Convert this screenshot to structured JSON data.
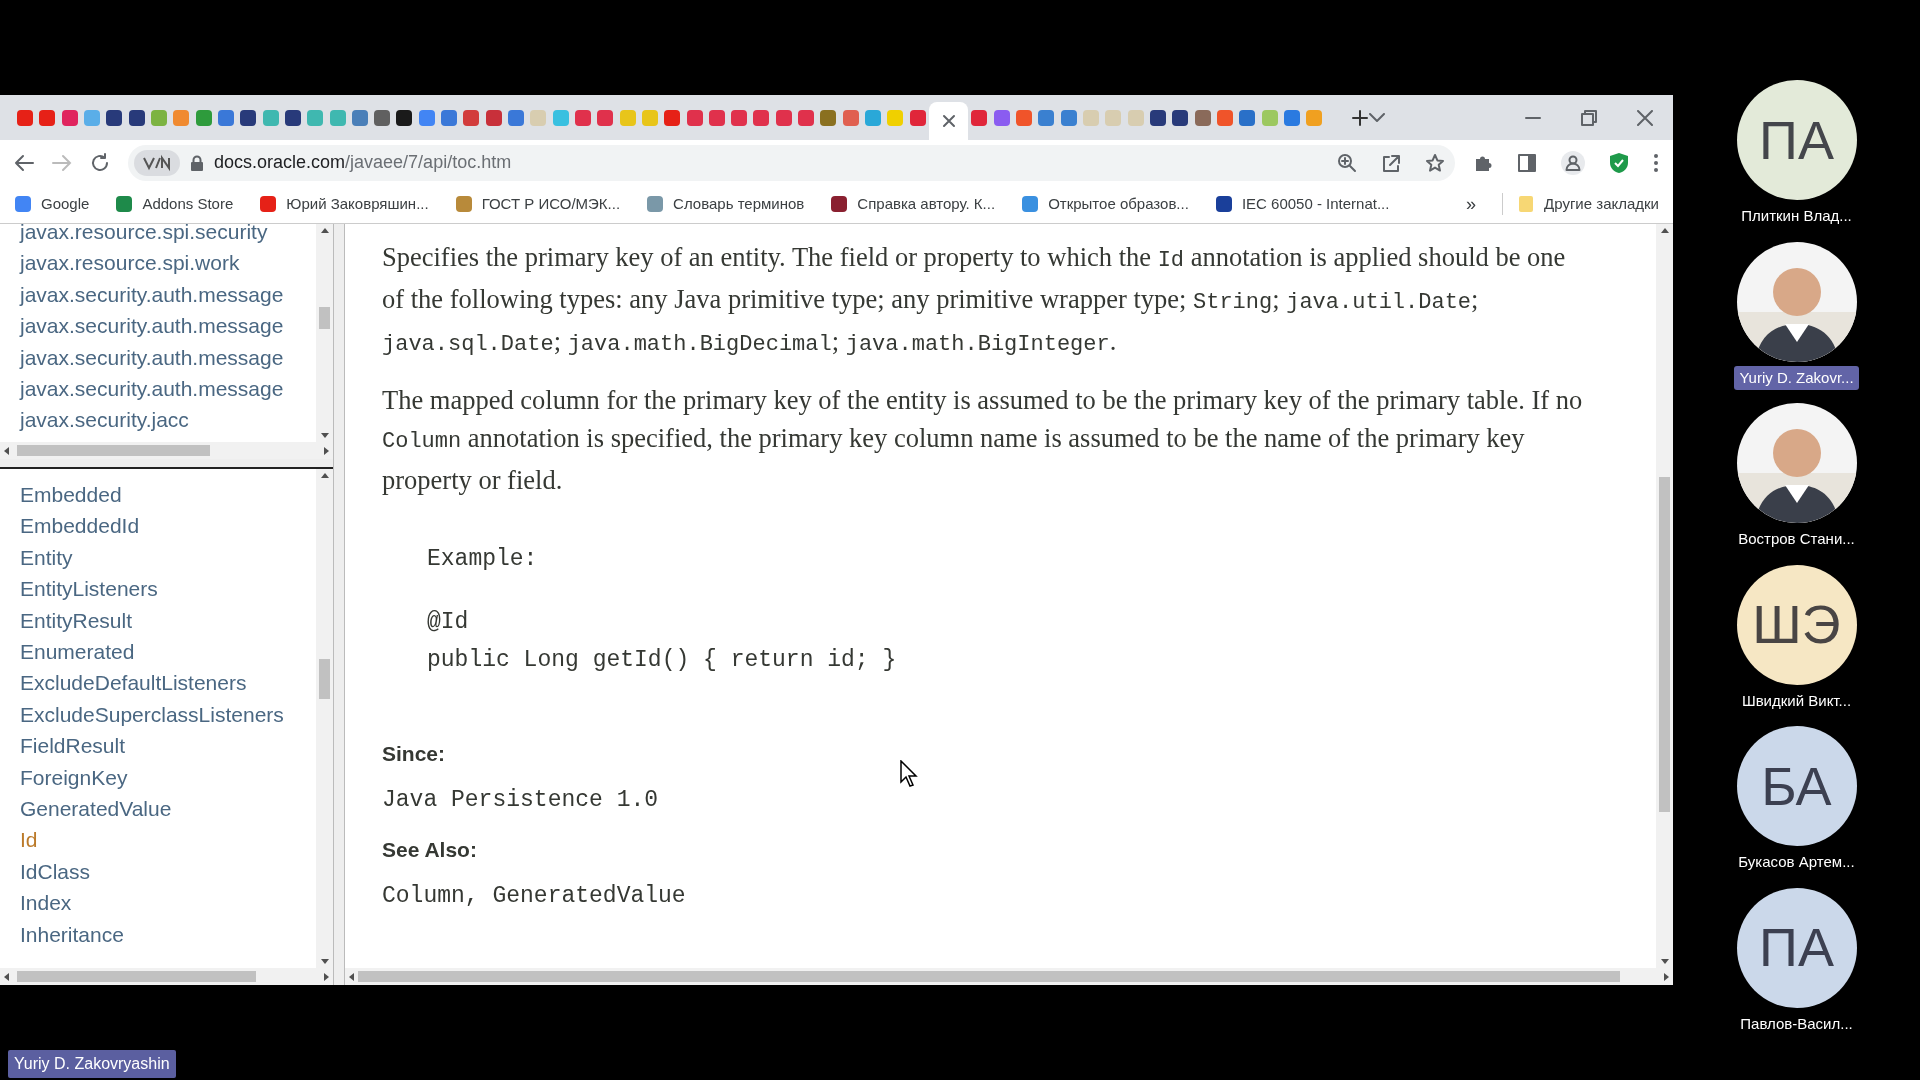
{
  "browser": {
    "tabs": [
      {
        "color": "#e62117",
        "selected": false
      },
      {
        "color": "#e62117",
        "selected": false
      },
      {
        "color": "#e0245e",
        "selected": false
      },
      {
        "color": "#5aaee8",
        "selected": false
      },
      {
        "color": "#283a7a",
        "selected": false
      },
      {
        "color": "#283a7a",
        "selected": false
      },
      {
        "color": "#7cb342",
        "selected": false
      },
      {
        "color": "#f08a30",
        "selected": false
      },
      {
        "color": "#2e9b3c",
        "selected": false
      },
      {
        "color": "#3a78d8",
        "selected": false
      },
      {
        "color": "#283a7a",
        "selected": false
      },
      {
        "color": "#3fb8b0",
        "selected": false
      },
      {
        "color": "#283a7a",
        "selected": false
      },
      {
        "color": "#3fb8b0",
        "selected": false
      },
      {
        "color": "#3fb8b0",
        "selected": false
      },
      {
        "color": "#4a7fb8",
        "selected": false
      },
      {
        "color": "#606060",
        "selected": false
      },
      {
        "color": "#1a1a1a",
        "selected": false
      },
      {
        "color": "#4285f4",
        "selected": false
      },
      {
        "color": "#3a78d8",
        "selected": false
      },
      {
        "color": "#d23c3c",
        "selected": false
      },
      {
        "color": "#c8303a",
        "selected": false
      },
      {
        "color": "#3a78d8",
        "selected": false
      },
      {
        "color": "#d8cdb0",
        "selected": false
      },
      {
        "color": "#39c0e0",
        "selected": false
      },
      {
        "color": "#e0314c",
        "selected": false
      },
      {
        "color": "#e0314c",
        "selected": false
      },
      {
        "color": "#e8c51a",
        "selected": false
      },
      {
        "color": "#e8c51a",
        "selected": false
      },
      {
        "color": "#e62117",
        "selected": false
      },
      {
        "color": "#e0314c",
        "selected": false
      },
      {
        "color": "#e0314c",
        "selected": false
      },
      {
        "color": "#e0314c",
        "selected": false
      },
      {
        "color": "#e0314c",
        "selected": false
      },
      {
        "color": "#e0314c",
        "selected": false
      },
      {
        "color": "#e0314c",
        "selected": false
      },
      {
        "color": "#8a7020",
        "selected": false
      },
      {
        "color": "#e06050",
        "selected": false
      },
      {
        "color": "#2aa8d8",
        "selected": false
      },
      {
        "color": "#f0d000",
        "selected": false
      },
      {
        "color": "#e0263a",
        "selected": false
      },
      {
        "selected": true
      },
      {
        "color": "#e0263a",
        "selected": false
      },
      {
        "color": "#8a5cf0",
        "selected": false
      },
      {
        "color": "#f0542a",
        "selected": false
      },
      {
        "color": "#3a80d0",
        "selected": false
      },
      {
        "color": "#3a80d0",
        "selected": false
      },
      {
        "color": "#d8cdb0",
        "selected": false
      },
      {
        "color": "#d8cdb0",
        "selected": false
      },
      {
        "color": "#d8cdb0",
        "selected": false
      },
      {
        "color": "#283a7a",
        "selected": false
      },
      {
        "color": "#283a7a",
        "selected": false
      },
      {
        "color": "#8a6a5a",
        "selected": false
      },
      {
        "color": "#f0542a",
        "selected": false
      },
      {
        "color": "#2a70c8",
        "selected": false
      },
      {
        "color": "#9cc860",
        "selected": false
      },
      {
        "color": "#2a7ae0",
        "selected": false
      },
      {
        "color": "#f0a020",
        "selected": false
      }
    ],
    "address": {
      "host": "docs.oracle.com",
      "path": "/javaee/7/api/toc.htm"
    },
    "bookmarks": [
      {
        "label": "Google",
        "color": "#4285f4"
      },
      {
        "label": "Addons Store",
        "color": "#1e8a4a"
      },
      {
        "label": "Юрий Заковряшин...",
        "color": "#e62117"
      },
      {
        "label": "ГОСТ Р ИСО/МЭК...",
        "color": "#b88a3a"
      },
      {
        "label": "Словарь терминов",
        "color": "#7a98a8"
      },
      {
        "label": "Справка автору. К...",
        "color": "#8a2030"
      },
      {
        "label": "Открытое образов...",
        "color": "#3a90e0"
      },
      {
        "label": "IEC 60050 - Internat...",
        "color": "#1a3f9a"
      }
    ],
    "overflow": "»",
    "other_bookmarks": "Другие закладки"
  },
  "packages_frame": {
    "items": [
      "javax.resource.spi.security",
      "javax.resource.spi.work",
      "javax.security.auth.message",
      "javax.security.auth.message",
      "javax.security.auth.message",
      "javax.security.auth.message",
      "javax.security.jacc"
    ]
  },
  "classes_frame": {
    "items": [
      {
        "label": "Embedded",
        "selected": false
      },
      {
        "label": "EmbeddedId",
        "selected": false
      },
      {
        "label": "Entity",
        "selected": false
      },
      {
        "label": "EntityListeners",
        "selected": false
      },
      {
        "label": "EntityResult",
        "selected": false
      },
      {
        "label": "Enumerated",
        "selected": false
      },
      {
        "label": "ExcludeDefaultListeners",
        "selected": false
      },
      {
        "label": "ExcludeSuperclassListeners",
        "selected": false
      },
      {
        "label": "FieldResult",
        "selected": false
      },
      {
        "label": "ForeignKey",
        "selected": false
      },
      {
        "label": "GeneratedValue",
        "selected": false
      },
      {
        "label": "Id",
        "selected": true
      },
      {
        "label": "IdClass",
        "selected": false
      },
      {
        "label": "Index",
        "selected": false
      },
      {
        "label": "Inheritance",
        "selected": false
      }
    ]
  },
  "doc": {
    "paragraphs": [
      [
        {
          "text": "Specifies the primary key of an entity. The field or property to which the ",
          "code": false
        },
        {
          "text": "Id",
          "code": true
        },
        {
          "text": " annotation is applied should be one of the following types: any Java primitive type; any primitive wrapper type; ",
          "code": false
        },
        {
          "text": "String",
          "code": true
        },
        {
          "text": "; ",
          "code": false
        },
        {
          "text": "java.util.Date",
          "code": true
        },
        {
          "text": "; ",
          "code": false
        },
        {
          "text": "java.sql.Date",
          "code": true
        },
        {
          "text": "; ",
          "code": false
        },
        {
          "text": "java.math.BigDecimal",
          "code": true
        },
        {
          "text": "; ",
          "code": false
        },
        {
          "text": "java.math.BigInteger",
          "code": true
        },
        {
          "text": ".",
          "code": false
        }
      ],
      [
        {
          "text": "The mapped column for the primary key of the entity is assumed to be the primary key of the primary table. If no ",
          "code": false
        },
        {
          "text": "Column",
          "code": true
        },
        {
          "text": " annotation is specified, the primary key column name is assumed to be the name of the primary key property or field.",
          "code": false
        }
      ]
    ],
    "example_label": "Example:",
    "code_lines": [
      "@Id",
      "public Long getId() { return id; }"
    ],
    "since_label": "Since:",
    "since": "Java Persistence 1.0",
    "see_also_label": "See Also:",
    "see_also": "Column, GeneratedValue"
  },
  "participants": [
    {
      "name": "Плиткин Влад...",
      "kind": "initials",
      "initials": "ПА",
      "color": "#e3ead9",
      "speaking": false
    },
    {
      "name": "Yuriy D. Zakovr...",
      "speaking": true
    },
    {
      "name": "Востров Стани...",
      "speaking": false
    },
    {
      "name": "Швидкий Викт...",
      "kind": "initials",
      "initials": "ШЭ",
      "color": "#f6e7c4",
      "speaking": false
    },
    {
      "name": "Букасов Артем...",
      "kind": "initials",
      "initials": "БА",
      "color": "#cbd8ea",
      "speaking": false
    },
    {
      "name": "Павлов-Васил...",
      "kind": "initials",
      "initials": "ПА",
      "color": "#cbd8ea",
      "speaking": false
    }
  ],
  "presenter_label": "Yuriy D. Zakovryashin"
}
